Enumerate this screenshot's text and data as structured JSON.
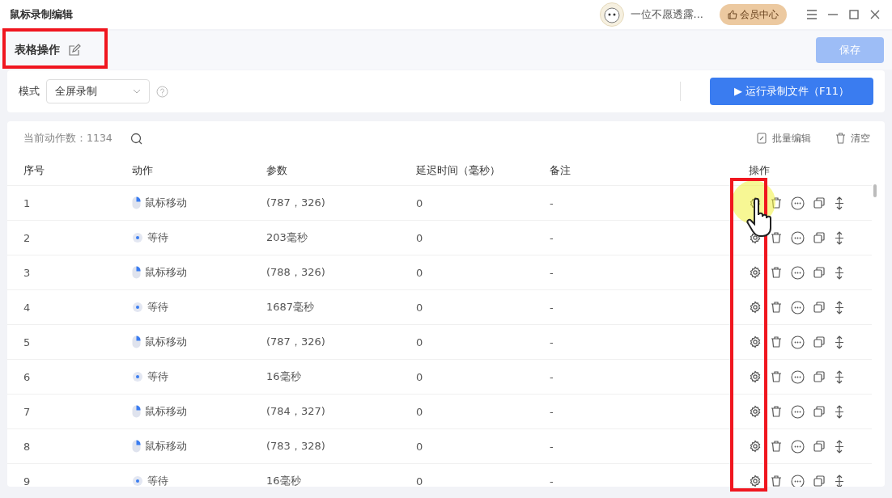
{
  "window": {
    "title": "鼠标录制编辑",
    "username": "一位不愿透露...",
    "vip_button": "会员中心"
  },
  "header": {
    "title": "表格操作",
    "save_button": "保存"
  },
  "mode": {
    "label": "模式",
    "value": "全屏录制",
    "run_button": "▶ 运行录制文件（F11）"
  },
  "table": {
    "count_label": "当前动作数：1134",
    "batch_edit": "批量编辑",
    "clear": "清空",
    "columns": [
      "序号",
      "动作",
      "参数",
      "延迟时间（毫秒）",
      "备注",
      "操作"
    ],
    "rows": [
      {
        "index": "1",
        "kind": "mouse",
        "action": "鼠标移动",
        "params": "(787，326)",
        "delay": "0",
        "note": "-"
      },
      {
        "index": "2",
        "kind": "wait",
        "action": "等待",
        "params": "203毫秒",
        "delay": "0",
        "note": "-"
      },
      {
        "index": "3",
        "kind": "mouse",
        "action": "鼠标移动",
        "params": "(788，326)",
        "delay": "0",
        "note": "-"
      },
      {
        "index": "4",
        "kind": "wait",
        "action": "等待",
        "params": "1687毫秒",
        "delay": "0",
        "note": "-"
      },
      {
        "index": "5",
        "kind": "mouse",
        "action": "鼠标移动",
        "params": "(787，326)",
        "delay": "0",
        "note": "-"
      },
      {
        "index": "6",
        "kind": "wait",
        "action": "等待",
        "params": "16毫秒",
        "delay": "0",
        "note": "-"
      },
      {
        "index": "7",
        "kind": "mouse",
        "action": "鼠标移动",
        "params": "(784，327)",
        "delay": "0",
        "note": "-"
      },
      {
        "index": "8",
        "kind": "mouse",
        "action": "鼠标移动",
        "params": "(783，328)",
        "delay": "0",
        "note": "-"
      },
      {
        "index": "9",
        "kind": "wait",
        "action": "等待",
        "params": "16毫秒",
        "delay": "0",
        "note": "-"
      }
    ]
  }
}
